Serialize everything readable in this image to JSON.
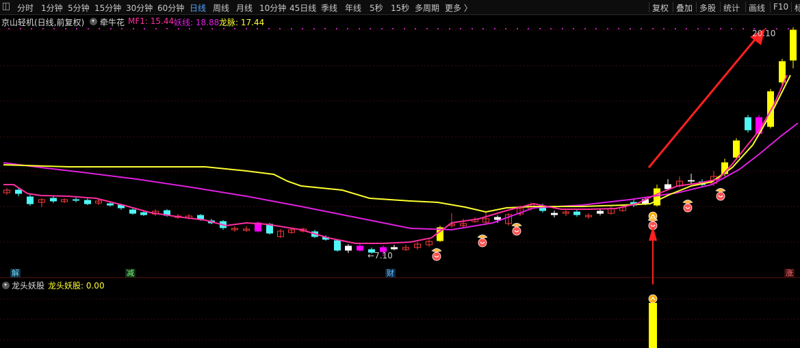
{
  "toolbar": {
    "items": [
      "分时",
      "1分钟",
      "5分钟",
      "15分钟",
      "30分钟",
      "60分钟",
      "日线",
      "周线",
      "月线",
      "10分钟",
      "45日线",
      "季线",
      "年线",
      "5秒",
      "15秒",
      "多周期",
      "更多 〉"
    ],
    "active": "日线",
    "right_items": [
      "复权",
      "叠加",
      "多股",
      "统计",
      "画线",
      "F10",
      "标"
    ]
  },
  "info": {
    "stock": "京山轻机(日线,前复权)",
    "indicator_name": "牵牛花",
    "mf1_label": "MF1: 15.44",
    "yao_label": "妖线: 18.88",
    "long_label": "龙脉: 17.44"
  },
  "sub": {
    "indicator_name": "龙头妖股",
    "value_label": "龙头妖股: 0.00"
  },
  "tags": {
    "jie": "解",
    "jian": "减",
    "cai": "财",
    "zhang": "涨"
  },
  "annotations": {
    "low": "←7.10",
    "high": "20.10"
  },
  "colors": {
    "up": "#ff3b3b",
    "down": "#4ff6f6",
    "yellow_candle": "#ffff00",
    "magenta_candle": "#ff00ff",
    "mf1": "#ff2fa0",
    "yao": "#e020e0",
    "long": "#ffff30",
    "arrow": "#ff2020"
  },
  "chart_data": {
    "type": "candlestick",
    "series": [
      {
        "name": "MF1",
        "values": [
          15.44
        ]
      },
      {
        "name": "妖线",
        "values": [
          18.88
        ]
      },
      {
        "name": "龙脉",
        "values": [
          17.44
        ]
      },
      {
        "name": "龙头妖股",
        "values": [
          0.0
        ]
      }
    ],
    "low": 7.1,
    "high": 20.1
  }
}
